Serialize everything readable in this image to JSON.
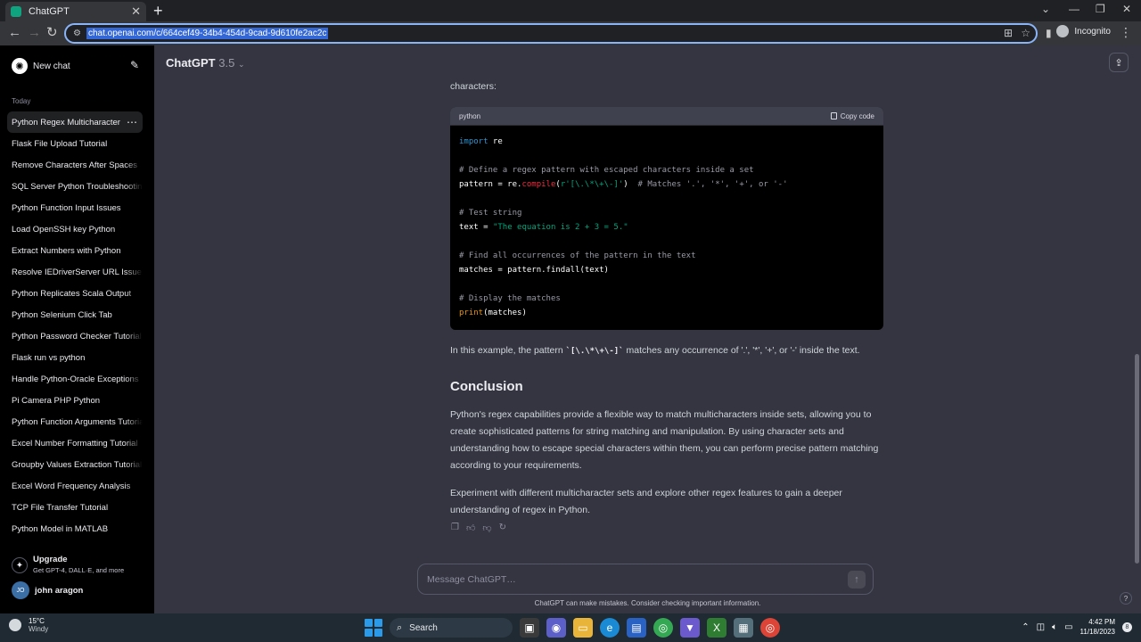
{
  "browser": {
    "tab_title": "ChatGPT",
    "url": "chat.openai.com/c/664cef49-34b4-454d-9cad-9d610fe2ac2c",
    "incognito_label": "Incognito"
  },
  "sidebar": {
    "new_chat_label": "New chat",
    "section_label": "Today",
    "items": [
      {
        "label": "Python Regex Multicharacter"
      },
      {
        "label": "Flask File Upload Tutorial"
      },
      {
        "label": "Remove Characters After Spaces"
      },
      {
        "label": "SQL Server Python Troubleshooting"
      },
      {
        "label": "Python Function Input Issues"
      },
      {
        "label": "Load OpenSSH key Python"
      },
      {
        "label": "Extract Numbers with Python"
      },
      {
        "label": "Resolve IEDriverServer URL Issue"
      },
      {
        "label": "Python Replicates Scala Output"
      },
      {
        "label": "Python Selenium Click Tab"
      },
      {
        "label": "Python Password Checker Tutorial"
      },
      {
        "label": "Flask run vs python"
      },
      {
        "label": "Handle Python-Oracle Exceptions"
      },
      {
        "label": "Pi Camera PHP Python"
      },
      {
        "label": "Python Function Arguments Tutorial"
      },
      {
        "label": "Excel Number Formatting Tutorial"
      },
      {
        "label": "Groupby Values Extraction Tutorial"
      },
      {
        "label": "Excel Word Frequency Analysis"
      },
      {
        "label": "TCP File Transfer Tutorial"
      },
      {
        "label": "Python Model in MATLAB"
      }
    ],
    "upgrade_title": "Upgrade",
    "upgrade_subtitle": "Get GPT-4, DALL·E, and more",
    "user_initials": "JO",
    "user_name": "john aragon"
  },
  "header": {
    "model_name": "ChatGPT",
    "model_version": "3.5"
  },
  "message": {
    "intro_tail": "characters:",
    "code_language": "python",
    "copy_label": "Copy code",
    "after_code_prefix": "In this example, the pattern ",
    "after_code_pattern": "`[\\.\\*\\+\\-]`",
    "after_code_suffix": " matches any occurrence of '.', '*', '+', or '-' inside the text.",
    "heading": "Conclusion",
    "conclusion_p1": "Python's regex capabilities provide a flexible way to match multicharacters inside sets, allowing you to create sophisticated patterns for string matching and manipulation. By using character sets and understanding how to escape special characters within them, you can perform precise pattern matching according to your requirements.",
    "conclusion_p2": "Experiment with different multicharacter sets and explore other regex features to gain a deeper understanding of regex in Python."
  },
  "composer": {
    "placeholder": "Message ChatGPT…",
    "disclaimer": "ChatGPT can make mistakes. Consider checking important information."
  },
  "taskbar": {
    "temperature": "15°C",
    "weather": "Windy",
    "search_label": "Search",
    "time": "4:42 PM",
    "date": "11/18/2023",
    "notifications": "8"
  }
}
